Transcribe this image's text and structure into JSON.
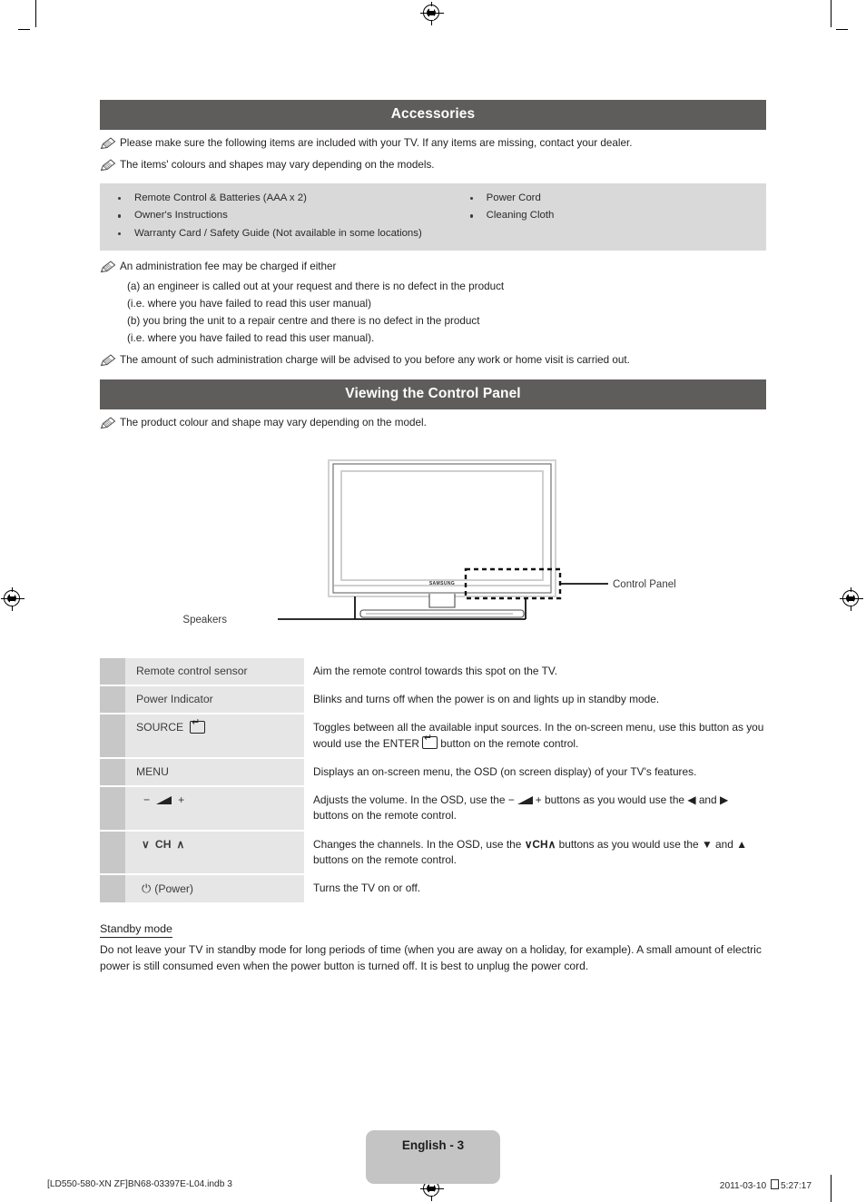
{
  "sections": {
    "accessories": {
      "title": "Accessories",
      "notes": [
        "Please make sure the following items are included with your TV. If any items are missing, contact your dealer.",
        "The items' colours and shapes may vary depending on the models."
      ],
      "items_left": [
        "Remote Control & Batteries (AAA x 2)",
        "Owner's Instructions",
        "Warranty Card / Safety Guide (Not available in some locations)"
      ],
      "items_right": [
        "Power Cord",
        "Cleaning Cloth"
      ],
      "fee_note": "An administration fee may be charged if either",
      "fee_lines": [
        "(a) an engineer is called out at your request and there is no defect in the product",
        "(i.e. where you have failed to read this user manual)",
        "(b) you bring the unit to a repair centre and there is no defect in the product",
        "(i.e. where you have failed to read this user manual)."
      ],
      "charge_note": "The amount of such administration charge will be advised to you before any work or home visit is carried out."
    },
    "control_panel": {
      "title": "Viewing the Control Panel",
      "note": "The product colour and shape may vary depending on the model.",
      "diagram": {
        "brand": "SAMSUNG",
        "callout_control_panel": "Control Panel",
        "callout_speakers": "Speakers"
      },
      "rows": [
        {
          "label": "Remote control sensor",
          "label_icon": "",
          "desc": "Aim the remote control towards this spot on the TV."
        },
        {
          "label": "Power Indicator",
          "label_icon": "",
          "desc": "Blinks and turns off when the power is on and lights up in standby mode."
        },
        {
          "label": "SOURCE",
          "label_icon": "enter-key-icon",
          "desc_pre": "Toggles between all the available input sources. In the on-screen menu, use this button as you would use the ",
          "desc_mid": "ENTER",
          "desc_post": " button on the remote control."
        },
        {
          "label": "MENU",
          "label_icon": "",
          "desc": "Displays an on-screen menu, the OSD (on screen display) of your TV's features."
        },
        {
          "label_minus": "−",
          "label_plus": "+",
          "label_icon": "volume-triangle-icon",
          "desc_pre": "Adjusts the volume. In the OSD, use the ",
          "desc_minus": "−",
          "desc_plus": "+",
          "desc_mid": " buttons as you would use the ",
          "desc_left_arrow": "◀",
          "desc_and": " and ",
          "desc_right_arrow": "▶",
          "desc_post": " buttons on the remote control."
        },
        {
          "label_down": "∨",
          "label_ch": "CH",
          "label_up": "∧",
          "desc_pre": "Changes the channels. In the OSD, use the ",
          "desc_down": "∨",
          "desc_ch": "CH",
          "desc_up": "∧",
          "desc_mid": " buttons as you would use the ",
          "desc_dn_arrow": "▼",
          "desc_and": " and ",
          "desc_up_arrow": "▲",
          "desc_post": " buttons on the remote control."
        },
        {
          "label_power_icon": "power-icon",
          "label": "(Power)",
          "desc": "Turns the TV on or off."
        }
      ]
    },
    "standby": {
      "title": "Standby mode",
      "body": "Do not leave your TV in standby mode for long periods of time (when you are away on a holiday, for example). A small amount of electric power is still consumed even when the power button is turned off. It is best to unplug the power cord."
    }
  },
  "footer": {
    "page_label": "English - 3",
    "file_info": "[LD550-580-XN ZF]BN68-03397E-L04.indb   3",
    "date": "2011-03-10",
    "time": "5:27:17"
  },
  "colors": {
    "section_bar": "#5f5c5c",
    "accessory_table": "#d9d9d9",
    "row_label": "#e6e6e6",
    "row_number": "#c7c7c7",
    "page_badge": "#c4c4c4"
  }
}
